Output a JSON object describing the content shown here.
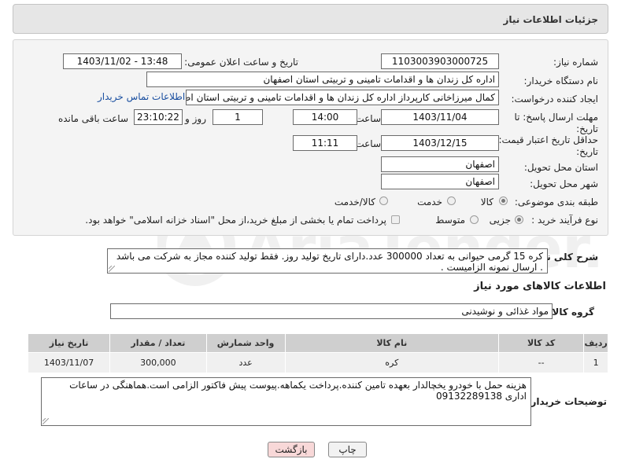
{
  "header": {
    "title": "جزئیات اطلاعات نیاز"
  },
  "labels": {
    "need_number": "شماره نیاز:",
    "announce_datetime": "تاریخ و ساعت اعلان عمومی:",
    "buyer_org": "نام دستگاه خریدار:",
    "requester": "ایجاد کننده درخواست:",
    "reply_deadline": "مهلت ارسال پاسخ: تا",
    "date_suffix": "تاریخ:",
    "time": "ساعت",
    "day_and": "روز و",
    "hours_left": "ساعت باقی مانده",
    "validity_deadline": "حداقل تاریخ اعتبار قیمت: تا",
    "province": "استان محل تحویل:",
    "city": "شهر محل تحویل:",
    "category": "طبقه بندی موضوعی:",
    "process_type": "نوع فرآیند خرید :",
    "general_description": "شرح کلی نیاز:",
    "goods_info": "اطلاعات کالاهای مورد نیاز",
    "goods_group": "گروه کالا:",
    "buyer_notes": "توضیحات خریدار:"
  },
  "fields": {
    "need_number": "1103003903000725",
    "announce_datetime": "1403/11/02 - 13:48",
    "buyer_org": "اداره کل زندان ها و اقدامات تامینی و تربیتی استان اصفهان",
    "requester": "کمال میرزاخانی کارپرداز اداره کل زندان ها و اقدامات تامینی و تربیتی استان اصفهان",
    "contact_link": "اطلاعات تماس خریدار",
    "reply_date": "1403/11/04",
    "reply_time": "14:00",
    "days_left": "1",
    "time_left": "23:10:22",
    "validity_date": "1403/12/15",
    "validity_time": "11:11",
    "province": "اصفهان",
    "city": "اصفهان",
    "category_options": [
      "کالا",
      "خدمت",
      "کالا/خدمت"
    ],
    "category_selected": "کالا",
    "process_options": [
      "جزیی",
      "متوسط"
    ],
    "process_selected": "جزیی",
    "payment_note": "پرداخت تمام یا بخشی از مبلغ خرید،از محل \"اسناد خزانه اسلامی\" خواهد بود.",
    "general_description": "کره 15 گرمی حیوانی به تعداد 300000 عدد.دارای تاریخ تولید روز. فقط تولید کننده مجاز به شرکت می باشد . ارسال نمونه الزامیست .",
    "goods_group": "مواد غذائی و نوشیدنی",
    "buyer_notes": "هزینه حمل با خودرو یخچالدار بعهده تامین کننده.پرداخت یکماهه.پیوست پیش فاکتور الزامی است.هماهنگی در ساعات اداری 09132289138"
  },
  "table": {
    "headers": [
      "ردیف",
      "کد کالا",
      "نام کالا",
      "واحد شمارش",
      "تعداد / مقدار",
      "تاریخ نیاز"
    ],
    "rows": [
      {
        "row": "1",
        "code": "--",
        "name": "کره",
        "unit": "عدد",
        "qty": "300,000",
        "date": "1403/11/07"
      }
    ]
  },
  "buttons": {
    "print": "چاپ",
    "back": "بازگشت"
  },
  "watermark": {
    "text": "AriaTender.neT"
  },
  "colors": {
    "header_bg": "#e6e6e6",
    "panel_bg": "#f4f4f4",
    "link": "#1a4fa0",
    "table_head": "#cfcfcf",
    "back_button": "#f8d8d8"
  }
}
